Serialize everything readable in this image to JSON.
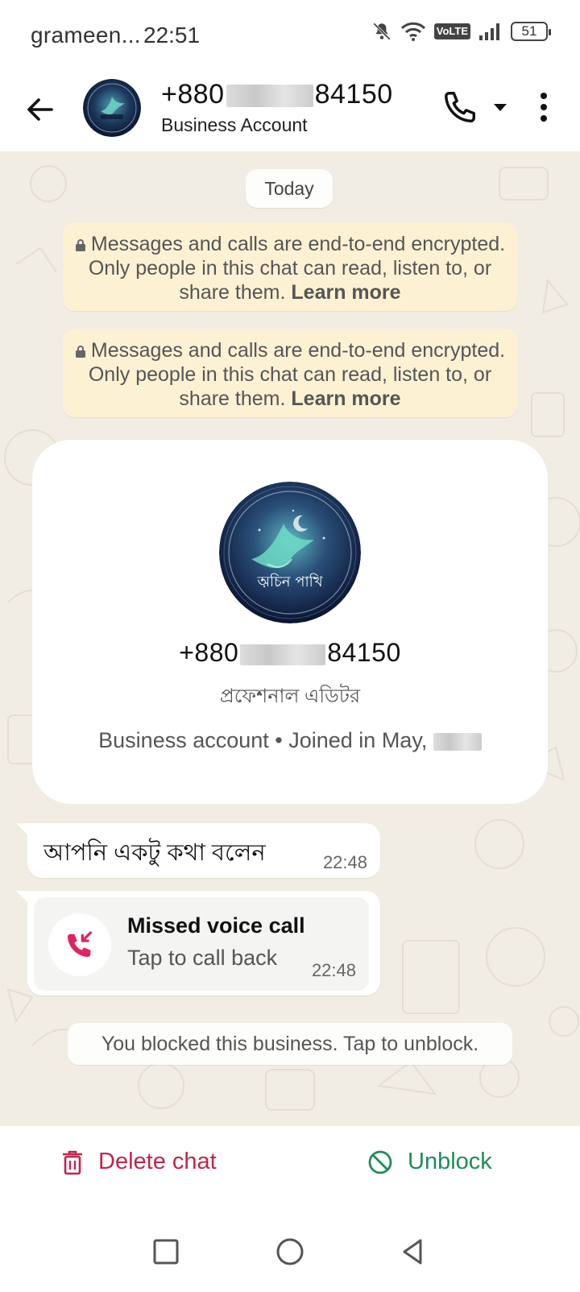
{
  "status_bar": {
    "carrier": "grameen...",
    "time": "22:51",
    "volte": "VoLTE",
    "battery": "51"
  },
  "header": {
    "number_prefix": "+880",
    "number_suffix": "84150",
    "subtitle": "Business Account"
  },
  "chat": {
    "date_label": "Today",
    "encryption_notices": [
      {
        "text": "Messages and calls are end-to-end encrypted. Only people in this chat can read, listen to, or share them.",
        "link": "Learn more"
      },
      {
        "text": "Messages and calls are end-to-end encrypted. Only people in this chat can read, listen to, or share them.",
        "link": "Learn more"
      }
    ],
    "profile_card": {
      "number_prefix": "+880",
      "number_suffix": "84150",
      "description": "প্রফেশনাল এডিটর",
      "meta": "Business account • Joined in May,",
      "avatar_caption": "অচিন পাখি"
    },
    "message": {
      "text": "আপনি একটু কথা বলেন",
      "time": "22:48"
    },
    "missed_call": {
      "title": "Missed voice call",
      "subtitle": "Tap to call back",
      "time": "22:48"
    },
    "blocked_notice": "You blocked this business. Tap to unblock."
  },
  "actions": {
    "delete_label": "Delete chat",
    "unblock_label": "Unblock"
  },
  "colors": {
    "delete": "#c2254a",
    "unblock": "#1e8d5a",
    "chat_bg": "#f1ece4",
    "notice_bg": "#fdf1d4"
  },
  "icons": [
    "back-arrow-icon",
    "phone-icon",
    "chevron-down-icon",
    "more-vert-icon",
    "lock-icon",
    "missed-call-icon",
    "trash-icon",
    "block-icon",
    "nav-square-icon",
    "nav-circle-icon",
    "nav-triangle-icon"
  ]
}
